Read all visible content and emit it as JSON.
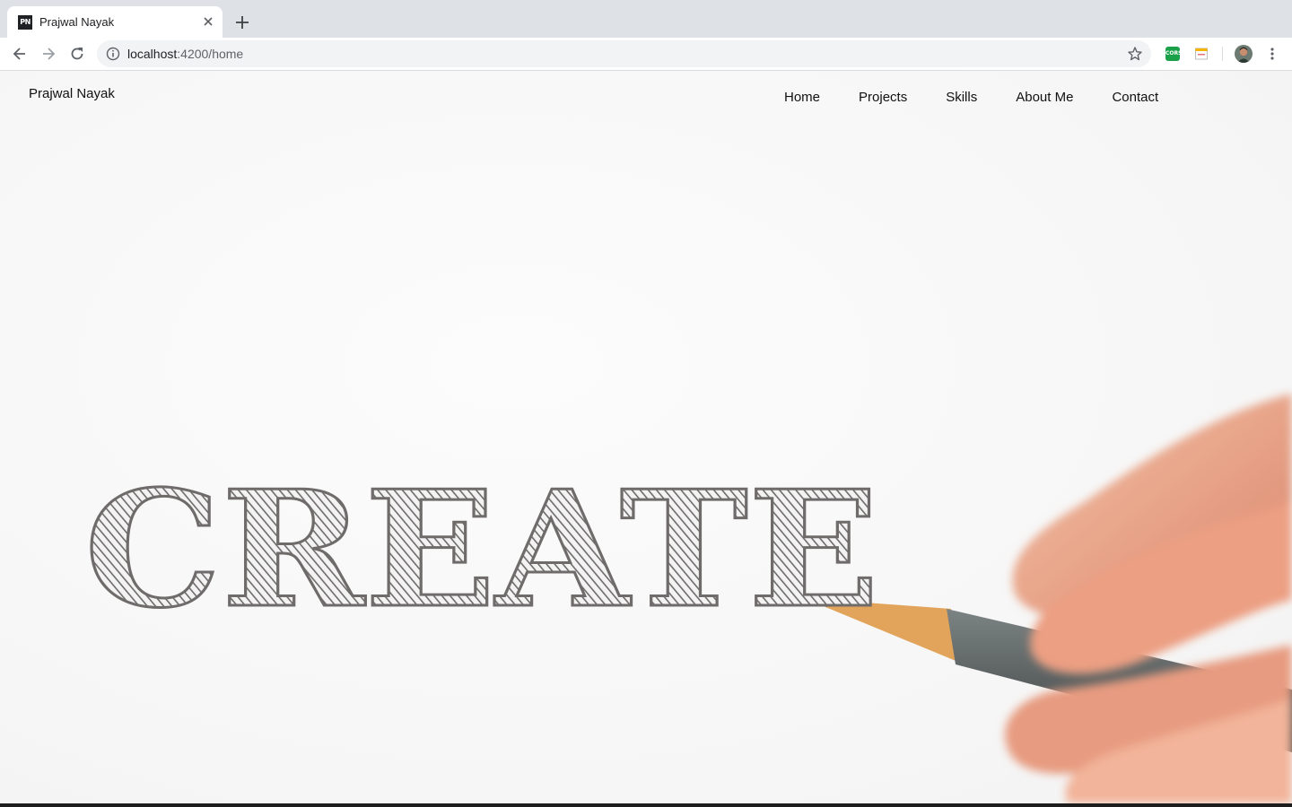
{
  "browser": {
    "tab": {
      "favicon_text": "PN",
      "title": "Prajwal Nayak"
    },
    "url": {
      "host": "localhost",
      "rest": ":4200/home"
    },
    "extensions": {
      "cors_label": "CORS"
    }
  },
  "page": {
    "brand": "Prajwal Nayak",
    "nav": [
      {
        "label": "Home"
      },
      {
        "label": "Projects"
      },
      {
        "label": "Skills"
      },
      {
        "label": "About Me"
      },
      {
        "label": "Contact"
      }
    ],
    "hero": {
      "word": "CREATE",
      "letter_color": "#6f6b6b"
    }
  },
  "colors": {
    "tabbar_bg": "#dee1e6",
    "page_bg": "#f7f7f7",
    "text": "#111111",
    "pencil_wood": "#e2a35a",
    "pencil_body": "#5b6161",
    "skin": "#e8a58a"
  }
}
